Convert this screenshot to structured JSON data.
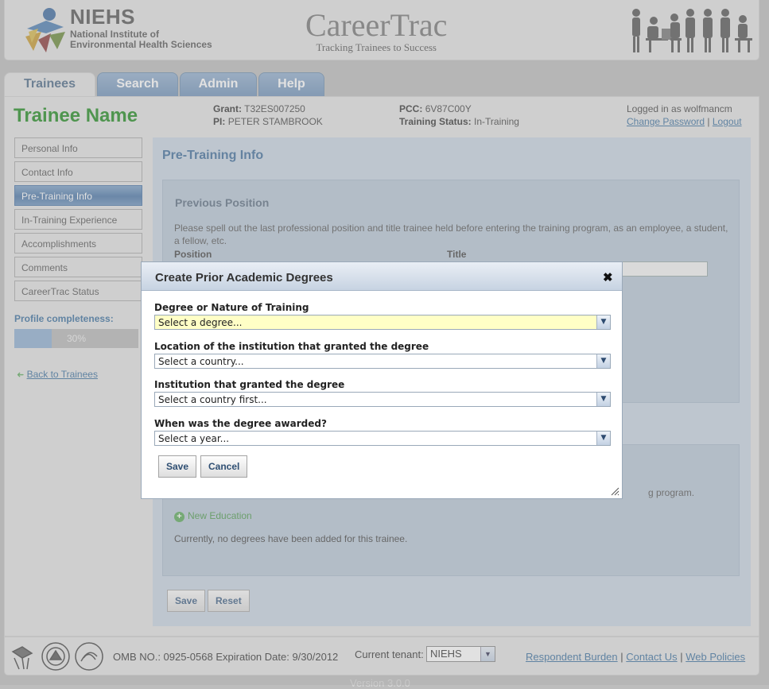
{
  "header": {
    "logo_abbr": "NIEHS",
    "logo_full": "National Institute of Environmental Health Sciences",
    "brand_title": "CareerTrac",
    "brand_tagline": "Tracking Trainees to Success"
  },
  "tabs": [
    {
      "label": "Trainees",
      "active": true
    },
    {
      "label": "Search",
      "active": false
    },
    {
      "label": "Admin",
      "active": false
    },
    {
      "label": "Help",
      "active": false
    }
  ],
  "trainee": {
    "name": "Trainee Name",
    "grant_label": "Grant:",
    "grant_value": "T32ES007250",
    "pi_label": "PI:",
    "pi_value": "PETER STAMBROOK",
    "pcc_label": "PCC:",
    "pcc_value": "6V87C00Y",
    "status_label": "Training Status:",
    "status_value": "In-Training"
  },
  "session": {
    "logged_in_text": "Logged in as wolfmancm",
    "change_password": "Change Password",
    "separator": "|",
    "logout": "Logout"
  },
  "sidenav": {
    "items": [
      {
        "label": "Personal Info"
      },
      {
        "label": "Contact Info"
      },
      {
        "label": "Pre-Training Info"
      },
      {
        "label": "In-Training Experience"
      },
      {
        "label": "Accomplishments"
      },
      {
        "label": "Comments"
      },
      {
        "label": "CareerTrac Status"
      }
    ],
    "active_index": 2,
    "completeness_label": "Profile completeness:",
    "completeness_percent": 30,
    "completeness_text": "30%",
    "back_link": "Back to Trainees"
  },
  "content": {
    "title": "Pre-Training Info",
    "previous_position": {
      "title": "Previous Position",
      "description": "Please spell out the last professional position and title trainee held before entering the training program, as an employee, a student, a fellow, etc.",
      "position_label": "Position",
      "title_label": "Title"
    },
    "education": {
      "description_tail": "g program.",
      "new_button": "New Education",
      "empty_message": "Currently, no degrees have been added for this trainee."
    },
    "save_button": "Save",
    "reset_button": "Reset"
  },
  "footer": {
    "omb": "OMB NO.: 0925-0568 Expiration Date: 9/30/2012",
    "tenant_label": "Current tenant:",
    "tenant_value": "NIEHS",
    "links": [
      "Respondent Burden",
      "Contact Us",
      "Web Policies"
    ],
    "version": "Version 3.0.0"
  },
  "dialog": {
    "title": "Create Prior Academic Degrees",
    "close_glyph": "✖",
    "fields": [
      {
        "label": "Degree or Nature of Training",
        "value": "Select a degree..."
      },
      {
        "label": "Location of the institution that granted the degree",
        "value": "Select a country..."
      },
      {
        "label": "Institution that granted the degree",
        "value": "Select a country first..."
      },
      {
        "label": "When was the degree awarded?",
        "value": "Select a year..."
      }
    ],
    "save_button": "Save",
    "cancel_button": "Cancel"
  },
  "icons": {
    "dropdown_arrow": "▼",
    "back_arrow": "➜",
    "add": "+"
  },
  "colors": {
    "trainee_name": "#1f8b1f",
    "accent_blue": "#3f6e9c",
    "active_nav": "#4a76a8",
    "highlight_field": "#ffffc6"
  }
}
